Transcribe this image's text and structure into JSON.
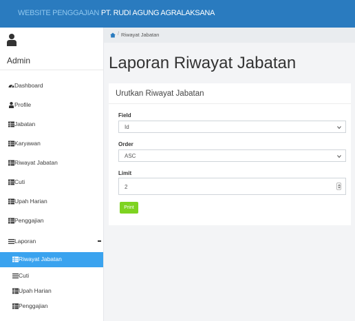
{
  "header": {
    "brand_prefix": "WEBSITE PENGGAJIAN",
    "brand_company": "PT. RUDI AGUNG AGRALAKSANA"
  },
  "user": {
    "name": "Admin"
  },
  "sidebar": {
    "items": [
      {
        "label": "Dashboard",
        "icon": "dashboard-icon"
      },
      {
        "label": "Profile",
        "icon": "user-icon"
      },
      {
        "label": "Jabatan",
        "icon": "table-icon"
      },
      {
        "label": "Karyawan",
        "icon": "table-icon"
      },
      {
        "label": "Riwayat Jabatan",
        "icon": "table-icon"
      },
      {
        "label": "Cuti",
        "icon": "table-icon"
      },
      {
        "label": "Upah Harian",
        "icon": "table-icon"
      },
      {
        "label": "Penggajian",
        "icon": "table-icon"
      },
      {
        "label": "Laporan",
        "icon": "list-icon"
      }
    ],
    "laporan_sub": [
      {
        "label": "Riwayat Jabatan",
        "active": true
      },
      {
        "label": "Cuti"
      },
      {
        "label": "Upah Harian"
      },
      {
        "label": "Penggajian"
      }
    ]
  },
  "breadcrumb": {
    "current": "Riwayat Jabatan"
  },
  "page": {
    "title": "Laporan Riwayat Jabatan"
  },
  "form": {
    "card_title": "Urutkan Riwayat Jabatan",
    "field_label": "Field",
    "field_value": "Id",
    "order_label": "Order",
    "order_value": "ASC",
    "limit_label": "Limit",
    "limit_value": "2",
    "print_label": "Print"
  },
  "colors": {
    "topbar": "#2a7bbf",
    "active_item": "#3aa3ef",
    "print_button": "#7ed321"
  }
}
